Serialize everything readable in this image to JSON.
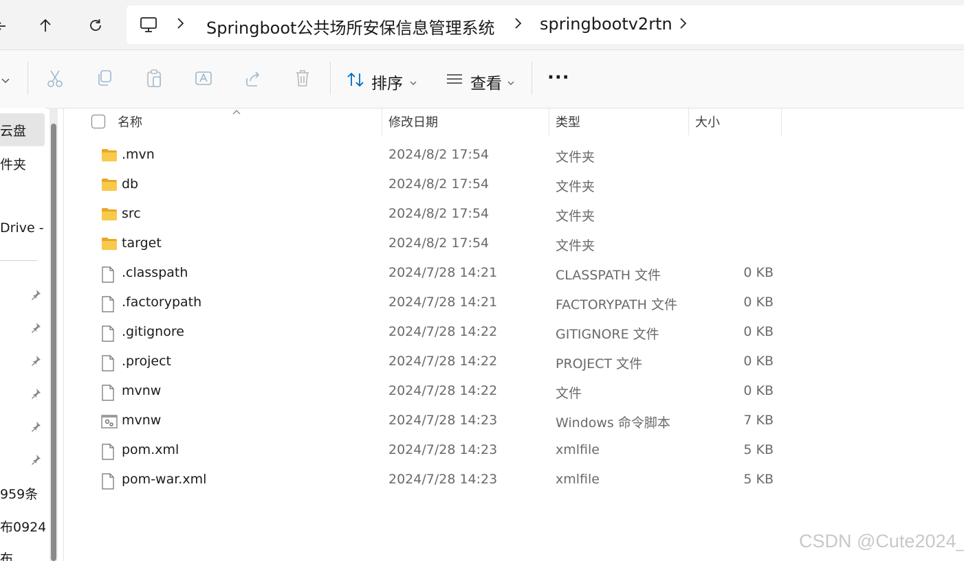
{
  "breadcrumb": {
    "items": [
      "Springboot公共场所安保信息管理系统",
      "springbootv2rtn"
    ]
  },
  "toolbar": {
    "sort_label": "排序",
    "view_label": "查看",
    "more_label": "···"
  },
  "sidebar": {
    "items": [
      "云盘",
      "件夹",
      "Drive - I",
      "959条",
      "布0924",
      "布"
    ]
  },
  "columns": {
    "name": "名称",
    "date": "修改日期",
    "type": "类型",
    "size": "大小"
  },
  "files": [
    {
      "name": ".mvn",
      "date": "2024/8/2 17:54",
      "type": "文件夹",
      "size": "",
      "icon": "folder-icon"
    },
    {
      "name": "db",
      "date": "2024/8/2 17:54",
      "type": "文件夹",
      "size": "",
      "icon": "folder-icon"
    },
    {
      "name": "src",
      "date": "2024/8/2 17:54",
      "type": "文件夹",
      "size": "",
      "icon": "folder-icon"
    },
    {
      "name": "target",
      "date": "2024/8/2 17:54",
      "type": "文件夹",
      "size": "",
      "icon": "folder-icon"
    },
    {
      "name": ".classpath",
      "date": "2024/7/28 14:21",
      "type": "CLASSPATH 文件",
      "size": "0 KB",
      "icon": "file-icon"
    },
    {
      "name": ".factorypath",
      "date": "2024/7/28 14:21",
      "type": "FACTORYPATH 文件",
      "size": "0 KB",
      "icon": "file-icon"
    },
    {
      "name": ".gitignore",
      "date": "2024/7/28 14:22",
      "type": "GITIGNORE 文件",
      "size": "0 KB",
      "icon": "file-icon"
    },
    {
      "name": ".project",
      "date": "2024/7/28 14:22",
      "type": "PROJECT 文件",
      "size": "0 KB",
      "icon": "file-icon"
    },
    {
      "name": "mvnw",
      "date": "2024/7/28 14:22",
      "type": "文件",
      "size": "0 KB",
      "icon": "file-icon"
    },
    {
      "name": "mvnw",
      "date": "2024/7/28 14:23",
      "type": "Windows 命令脚本",
      "size": "7 KB",
      "icon": "script-icon"
    },
    {
      "name": "pom.xml",
      "date": "2024/7/28 14:23",
      "type": "xmlfile",
      "size": "5 KB",
      "icon": "file-icon"
    },
    {
      "name": "pom-war.xml",
      "date": "2024/7/28 14:23",
      "type": "xmlfile",
      "size": "5 KB",
      "icon": "file-icon"
    }
  ],
  "watermark": "CSDN @Cute2024_",
  "colors": {
    "folder": "#f5c542",
    "accent": "#0067c0"
  }
}
